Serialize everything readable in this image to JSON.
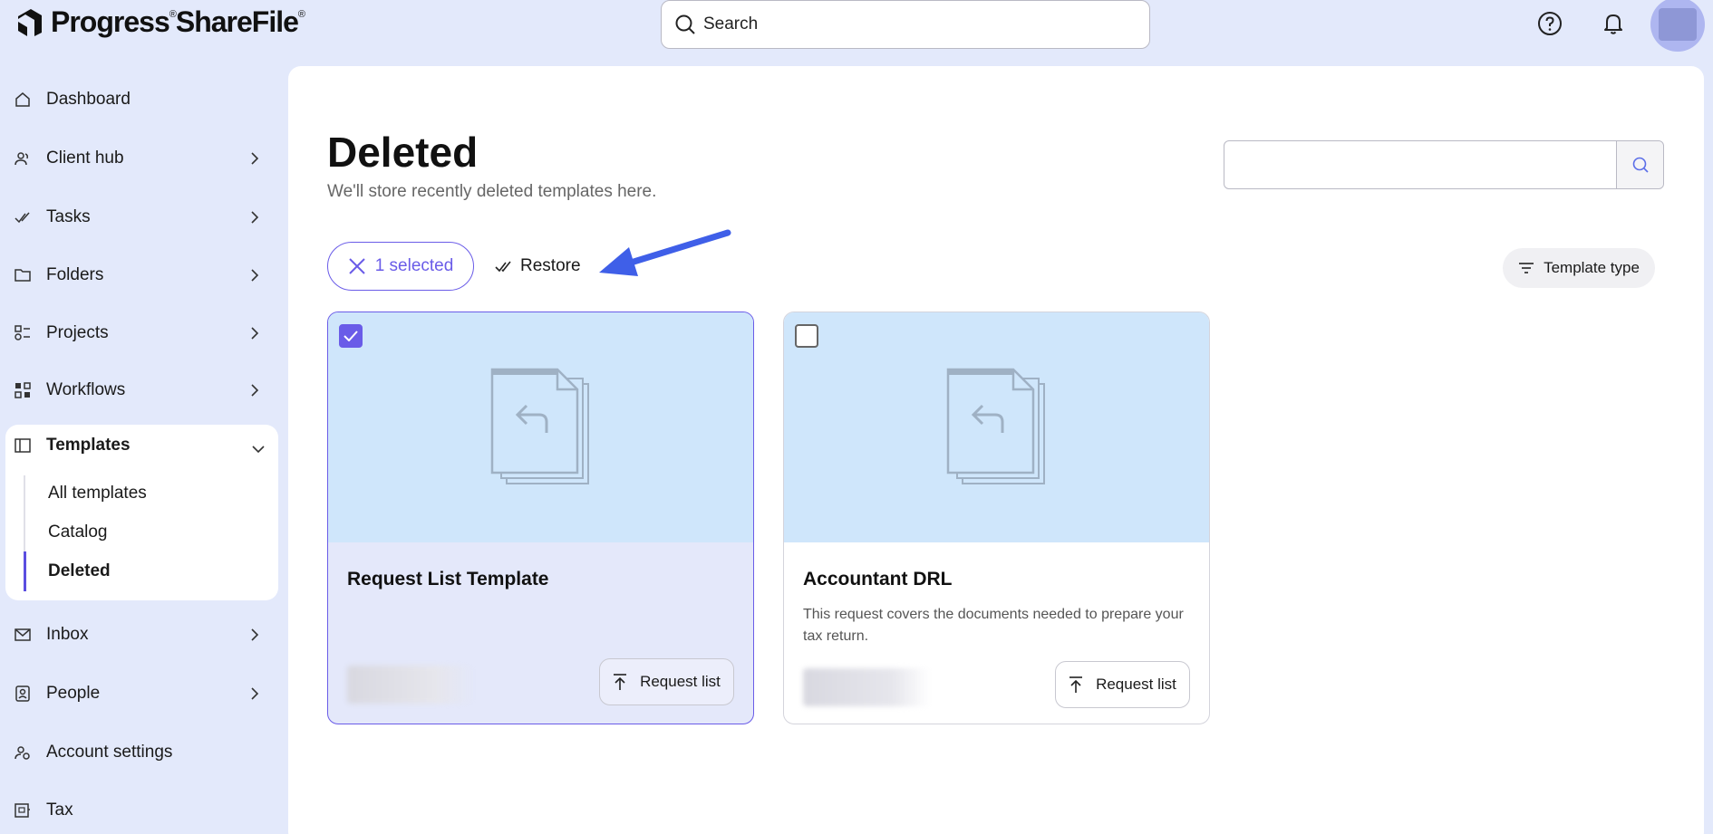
{
  "header": {
    "brand": "Progress",
    "product": "ShareFile",
    "search_placeholder": "Search"
  },
  "sidebar": {
    "items": [
      {
        "label": "Dashboard",
        "icon": "home-icon"
      },
      {
        "label": "Client hub",
        "icon": "client-hub-icon"
      },
      {
        "label": "Tasks",
        "icon": "tasks-icon"
      },
      {
        "label": "Folders",
        "icon": "folder-icon"
      },
      {
        "label": "Projects",
        "icon": "projects-icon"
      },
      {
        "label": "Workflows",
        "icon": "workflows-icon"
      },
      {
        "label": "Inbox",
        "icon": "mail-icon"
      },
      {
        "label": "People",
        "icon": "people-icon"
      },
      {
        "label": "Account settings",
        "icon": "settings-icon"
      },
      {
        "label": "Tax",
        "icon": "tax-icon"
      }
    ],
    "templates": {
      "label": "Templates",
      "sub_items": [
        "All templates",
        "Catalog",
        "Deleted"
      ],
      "active": "Deleted"
    }
  },
  "main": {
    "title": "Deleted",
    "subtitle": "We'll store recently deleted templates here.",
    "selected_label": "1 selected",
    "restore_label": "Restore",
    "filter_label": "Template type",
    "cards": [
      {
        "title": "Request List Template",
        "description": "",
        "type_label": "Request list",
        "selected": true
      },
      {
        "title": "Accountant DRL",
        "description": "This request covers the documents needed to prepare your tax return.",
        "type_label": "Request list",
        "selected": false
      }
    ]
  },
  "colors": {
    "accent": "#6a5ce8",
    "background": "#e3e9fb",
    "thumb": "#cfe6fb",
    "arrow": "#3f5fe8"
  }
}
